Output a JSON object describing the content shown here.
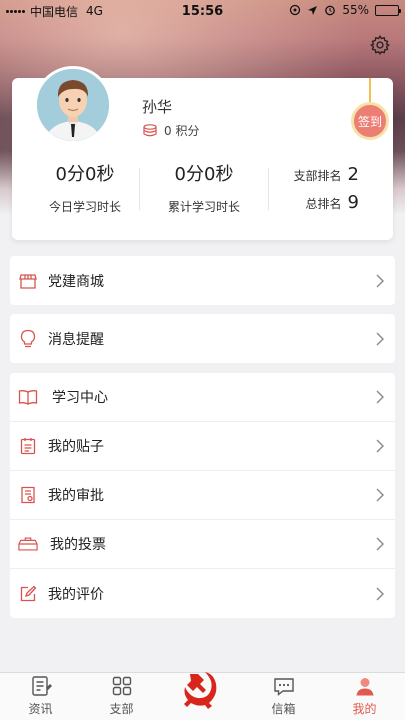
{
  "status_bar": {
    "carrier": "中国电信",
    "network": "4G",
    "time": "15:56",
    "battery": "55%",
    "battery_level": 0.55
  },
  "profile": {
    "name": "孙华",
    "points_text": "0 积分",
    "signin_label": "签到",
    "today_value": "0分0秒",
    "today_label": "今日学习时长",
    "total_value": "0分0秒",
    "total_label": "累计学习时长",
    "branch_rank_label": "支部排名",
    "branch_rank_value": "2",
    "total_rank_label": "总排名",
    "total_rank_value": "9"
  },
  "menu": {
    "mall": "党建商城",
    "reminder": "消息提醒",
    "study_center": "学习中心",
    "posts": "我的贴子",
    "approval": "我的审批",
    "votes": "我的投票",
    "review": "我的评价"
  },
  "tabs": [
    {
      "label": "资讯",
      "icon": "news-icon"
    },
    {
      "label": "支部",
      "icon": "branch-grid-icon"
    },
    {
      "label": "",
      "icon": "party-emblem-icon"
    },
    {
      "label": "信箱",
      "icon": "mailbox-icon"
    },
    {
      "label": "我的",
      "icon": "person-icon"
    }
  ],
  "colors": {
    "accent": "#e05a4e",
    "icon_red": "#d9534f",
    "signin_bg": "#ec7e74",
    "signin_ring": "#f6e3a8"
  }
}
